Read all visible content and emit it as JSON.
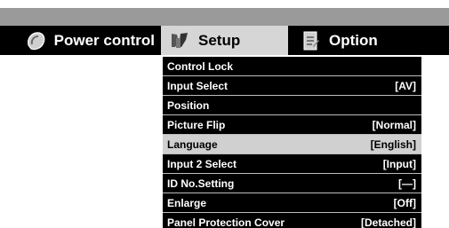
{
  "tabs": [
    {
      "label": "Power control",
      "icon": "power-icon"
    },
    {
      "label": "Setup",
      "icon": "wrench-icon"
    },
    {
      "label": "Option",
      "icon": "notepad-icon"
    }
  ],
  "menu": {
    "rows": [
      {
        "label": "Control Lock",
        "value": ""
      },
      {
        "label": "Input Select",
        "value": "[AV]"
      },
      {
        "label": "Position",
        "value": ""
      },
      {
        "label": "Picture Flip",
        "value": "[Normal]"
      },
      {
        "label": "Language",
        "value": "[English]"
      },
      {
        "label": "Input 2 Select",
        "value": "[Input]"
      },
      {
        "label": "ID No.Setting",
        "value": "[—]"
      },
      {
        "label": "Enlarge",
        "value": "[Off]"
      },
      {
        "label": "Panel Protection Cover",
        "value": "[Detached]"
      }
    ],
    "selected_index": 4
  },
  "colors": {
    "bar": "#000000",
    "top_strip": "#9a9a9a",
    "selected_tab": "#d6d6d6",
    "selected_row": "#d0d0d0"
  }
}
